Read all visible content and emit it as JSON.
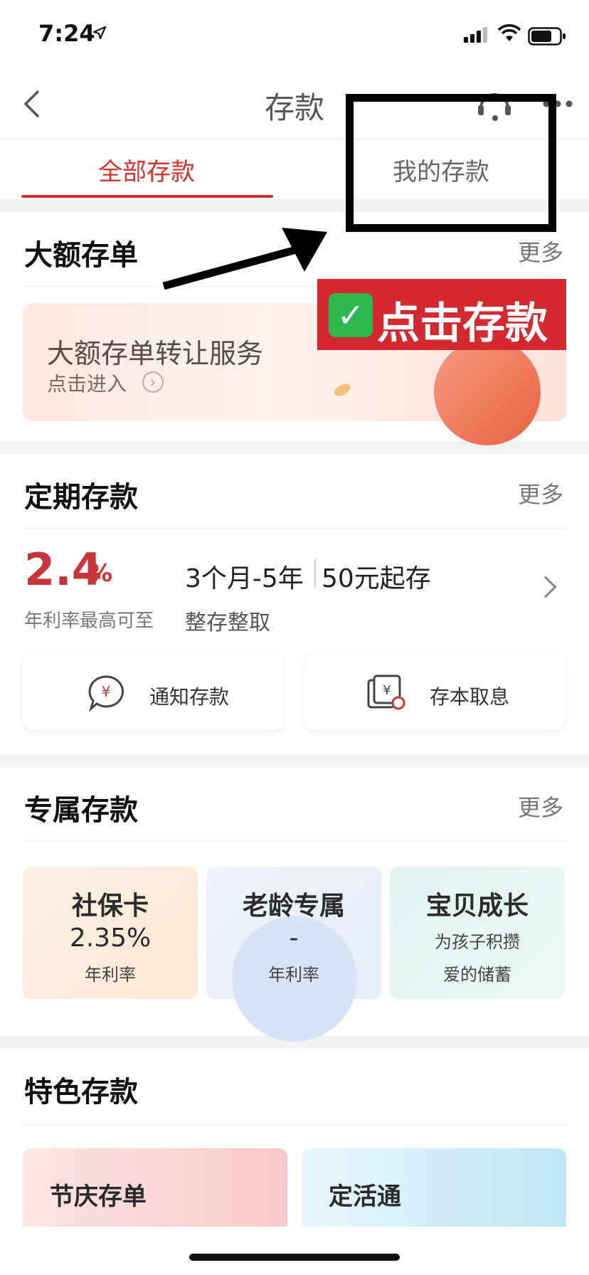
{
  "status_bar": {
    "time": "7:24"
  },
  "nav": {
    "title": "存款"
  },
  "tabs": [
    {
      "label": "全部存款",
      "active": true
    },
    {
      "label": "我的存款",
      "active": false
    }
  ],
  "annotation": {
    "badge_text": "点击存款",
    "check": "✓"
  },
  "large_cd": {
    "title": "大额存单",
    "more": "更多",
    "banner_title": "大额存单转让服务",
    "banner_subtitle": "点击进入"
  },
  "fixed": {
    "title": "定期存款",
    "more": "更多",
    "rate": "2.4",
    "rate_unit": "%",
    "rate_caption": "年利率最高可至",
    "term": "3个月-5年",
    "min_amount": "50元起存",
    "type": "整存整取",
    "buttons": [
      {
        "label": "通知存款",
        "icon": "yuan-chat-icon"
      },
      {
        "label": "存本取息",
        "icon": "yuan-card-icon"
      }
    ]
  },
  "exclusive": {
    "title": "专属存款",
    "more": "更多",
    "items": [
      {
        "title": "社保卡",
        "value": "2.35%",
        "sub": "年利率"
      },
      {
        "title": "老龄专属",
        "value": "-",
        "sub": "年利率"
      },
      {
        "title": "宝贝成长",
        "value": "为孩子积攒",
        "sub": "爱的储蓄"
      }
    ]
  },
  "special": {
    "title": "特色存款",
    "items": [
      {
        "title": "节庆存单"
      },
      {
        "title": "定活通"
      }
    ]
  },
  "colors": {
    "accent": "#d5312d",
    "rate": "#c8363a",
    "annotation_red": "#d42a2f",
    "check_green": "#2db84d"
  }
}
